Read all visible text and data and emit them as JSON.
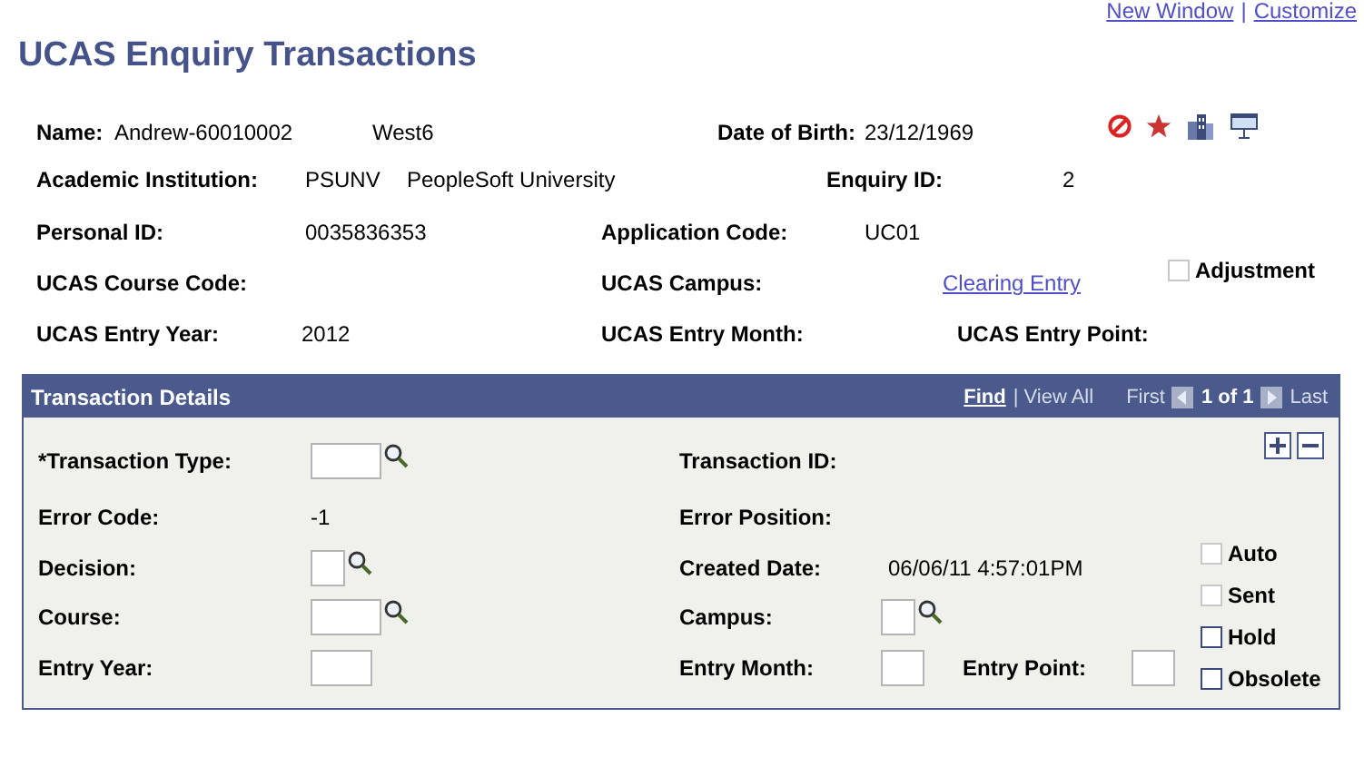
{
  "header_links": [
    "New Window",
    "Customize"
  ],
  "header_link_separator": "|",
  "title": "UCAS Enquiry Transactions",
  "info_rows": [
    [
      {
        "kind": "label",
        "text": "Name:"
      },
      {
        "kind": "value",
        "text": "Andrew-60010002"
      },
      {
        "kind": "value",
        "text": "West6"
      },
      {
        "kind": "label",
        "text": "Date of Birth:"
      },
      {
        "kind": "value",
        "text": "23/12/1969"
      },
      {
        "kind": "toolbar"
      }
    ],
    [
      {
        "kind": "label",
        "text": "Academic Institution:"
      },
      {
        "kind": "value",
        "text": "PSUNV"
      },
      {
        "kind": "value",
        "text": "PeopleSoft University"
      },
      {
        "kind": "label",
        "text": "Enquiry ID:"
      },
      {
        "kind": "value",
        "text": "2"
      }
    ],
    [
      {
        "kind": "label",
        "text": "Personal ID:"
      },
      {
        "kind": "value",
        "text": "0035836353"
      },
      {
        "kind": "label",
        "text": "Application Code:"
      },
      {
        "kind": "value",
        "text": "UC01"
      }
    ],
    [
      {
        "kind": "label",
        "text": "UCAS Course Code:"
      },
      {
        "kind": "label",
        "text": "UCAS Campus:"
      },
      {
        "kind": "link",
        "text": "Clearing Entry"
      },
      {
        "kind": "checkbox",
        "text": "Adjustment",
        "checked": false,
        "disabled": true
      }
    ],
    [
      {
        "kind": "label",
        "text": "UCAS Entry Year:"
      },
      {
        "kind": "value",
        "text": "2012"
      },
      {
        "kind": "label",
        "text": "UCAS Entry Month:"
      },
      {
        "kind": "label",
        "text": "UCAS Entry Point:"
      }
    ]
  ],
  "transaction_details": {
    "title": "Transaction Details",
    "find": "Find",
    "view_all": "| View All",
    "first": "First",
    "page": "1 of 1",
    "last": "Last",
    "rows": [
      [
        {
          "kind": "label",
          "text": "*Transaction Type:"
        },
        {
          "kind": "lookup"
        },
        {
          "kind": "label",
          "text": "Transaction ID:"
        }
      ],
      [
        {
          "kind": "label",
          "text": "Error Code:"
        },
        {
          "kind": "value",
          "text": "-1"
        },
        {
          "kind": "label",
          "text": "Error Position:"
        }
      ],
      [
        {
          "kind": "label",
          "text": "Decision:"
        },
        {
          "kind": "lookup"
        },
        {
          "kind": "label",
          "text": "Created Date:"
        },
        {
          "kind": "value",
          "text": "06/06/11  4:57:01PM"
        }
      ],
      [
        {
          "kind": "label",
          "text": "Course:"
        },
        {
          "kind": "lookup"
        },
        {
          "kind": "label",
          "text": "Campus:"
        },
        {
          "kind": "lookup"
        }
      ],
      [
        {
          "kind": "label",
          "text": "Entry Year:"
        },
        {
          "kind": "input"
        },
        {
          "kind": "label",
          "text": "Entry Month:"
        },
        {
          "kind": "input"
        },
        {
          "kind": "label",
          "text": "Entry Point:"
        },
        {
          "kind": "input"
        }
      ]
    ],
    "checkboxes": [
      {
        "text": "Auto",
        "checked": false,
        "disabled": true
      },
      {
        "text": "Sent",
        "checked": false,
        "disabled": true
      },
      {
        "text": "Hold",
        "checked": false,
        "disabled": false
      },
      {
        "text": "Obsolete",
        "checked": false,
        "disabled": false
      }
    ]
  }
}
